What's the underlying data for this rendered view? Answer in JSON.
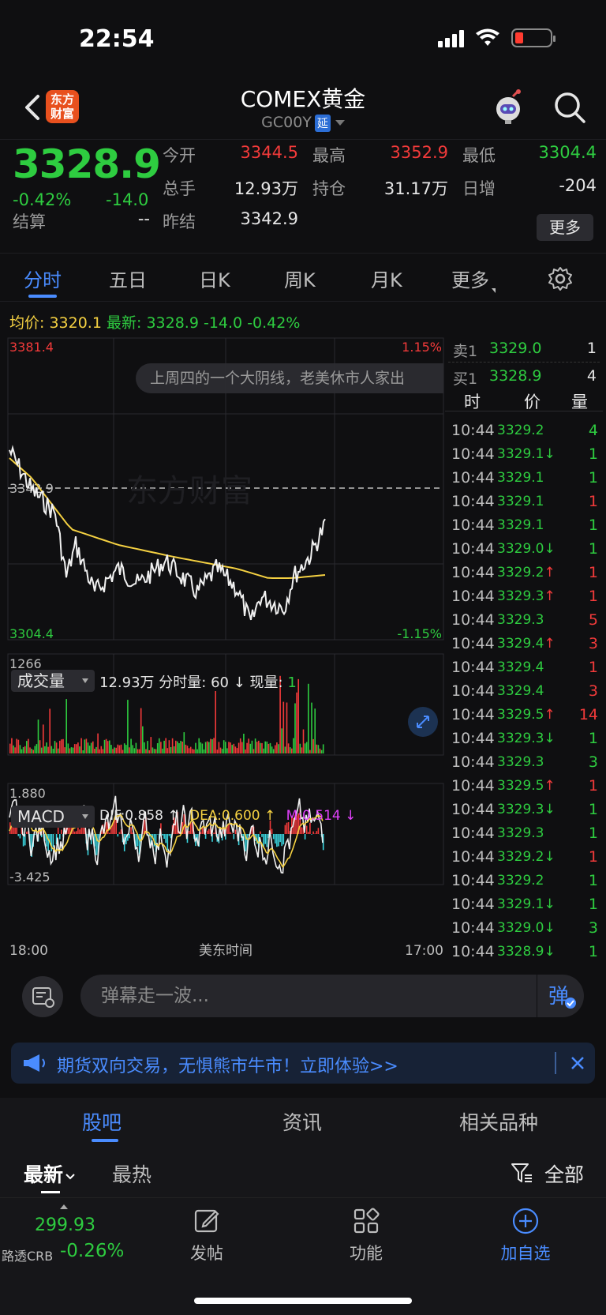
{
  "status": {
    "time": "22:54"
  },
  "nav": {
    "logo_text": "东方财富",
    "title": "COMEX黄金",
    "code": "GC00Y",
    "delay_tag": "延"
  },
  "quote": {
    "price": "3328.9",
    "change_pct": "-0.42%",
    "change_abs": "-14.0",
    "open_label": "今开",
    "open": "3344.5",
    "high_label": "最高",
    "high": "3352.9",
    "low_label": "最低",
    "low": "3304.4",
    "volume_label": "总手",
    "volume": "12.93万",
    "oi_label": "持仓",
    "oi": "31.17万",
    "daily_inc_label": "日增",
    "daily_inc": "-204",
    "settle_label": "结算",
    "settle": "--",
    "prev_settle_label": "昨结",
    "prev_settle": "3342.9",
    "more_label": "更多"
  },
  "period_tabs": [
    "分时",
    "五日",
    "日K",
    "周K",
    "月K",
    "更多"
  ],
  "avg_line": {
    "avg_label": "均价:",
    "avg": "3320.1",
    "latest_label": "最新:",
    "latest": "3328.9",
    "chg": "-14.0",
    "pct": "-0.42%"
  },
  "chart": {
    "y_max": "3381.4",
    "y_mid": "3342.9",
    "y_min": "3304.4",
    "pct_max": "1.15%",
    "pct_min": "-1.15%",
    "watermark": "东方财富",
    "ticker": "上周四的一个大阴线，老美休市人家出",
    "vol_max": "1266",
    "macd_max": "1.880",
    "macd_min": "-3.425",
    "x_start": "18:00",
    "x_mid": "美东时间",
    "x_end": "17:00"
  },
  "volume_panel": {
    "label": "成交量",
    "total": "12.93万",
    "fs_label": "分时量:",
    "fs_val": "60",
    "now_label": "现量:",
    "now_val": "1"
  },
  "macd_panel": {
    "label": "MACD",
    "dif": "DIF:0.858 ↑",
    "dea": "DEA:0.600 ↑",
    "m": "M:0.514 ↓"
  },
  "order_book": {
    "sell_label": "卖1",
    "sell_price": "3329.0",
    "sell_vol": "1",
    "buy_label": "买1",
    "buy_price": "3328.9",
    "buy_vol": "4",
    "head_time": "时",
    "head_price": "价",
    "head_vol": "量"
  },
  "trades": [
    {
      "time": "10:44",
      "price": "3329.2",
      "dir": "",
      "vol": "4",
      "pc": "g",
      "vc": "g"
    },
    {
      "time": "10:44",
      "price": "3329.1",
      "dir": "↓",
      "vol": "1",
      "pc": "g",
      "vc": "g"
    },
    {
      "time": "10:44",
      "price": "3329.1",
      "dir": "",
      "vol": "1",
      "pc": "g",
      "vc": "g"
    },
    {
      "time": "10:44",
      "price": "3329.1",
      "dir": "",
      "vol": "1",
      "pc": "g",
      "vc": "r"
    },
    {
      "time": "10:44",
      "price": "3329.1",
      "dir": "",
      "vol": "1",
      "pc": "g",
      "vc": "g"
    },
    {
      "time": "10:44",
      "price": "3329.0",
      "dir": "↓",
      "vol": "1",
      "pc": "g",
      "vc": "g"
    },
    {
      "time": "10:44",
      "price": "3329.2",
      "dir": "↑",
      "vol": "1",
      "pc": "g",
      "vc": "r"
    },
    {
      "time": "10:44",
      "price": "3329.3",
      "dir": "↑",
      "vol": "1",
      "pc": "g",
      "vc": "r"
    },
    {
      "time": "10:44",
      "price": "3329.3",
      "dir": "",
      "vol": "5",
      "pc": "g",
      "vc": "r"
    },
    {
      "time": "10:44",
      "price": "3329.4",
      "dir": "↑",
      "vol": "3",
      "pc": "g",
      "vc": "r"
    },
    {
      "time": "10:44",
      "price": "3329.4",
      "dir": "",
      "vol": "1",
      "pc": "g",
      "vc": "r"
    },
    {
      "time": "10:44",
      "price": "3329.4",
      "dir": "",
      "vol": "3",
      "pc": "g",
      "vc": "r"
    },
    {
      "time": "10:44",
      "price": "3329.5",
      "dir": "↑",
      "vol": "14",
      "pc": "g",
      "vc": "r"
    },
    {
      "time": "10:44",
      "price": "3329.3",
      "dir": "↓",
      "vol": "1",
      "pc": "g",
      "vc": "g"
    },
    {
      "time": "10:44",
      "price": "3329.3",
      "dir": "",
      "vol": "3",
      "pc": "g",
      "vc": "g"
    },
    {
      "time": "10:44",
      "price": "3329.5",
      "dir": "↑",
      "vol": "1",
      "pc": "g",
      "vc": "r"
    },
    {
      "time": "10:44",
      "price": "3329.3",
      "dir": "↓",
      "vol": "1",
      "pc": "g",
      "vc": "g"
    },
    {
      "time": "10:44",
      "price": "3329.3",
      "dir": "",
      "vol": "1",
      "pc": "g",
      "vc": "g"
    },
    {
      "time": "10:44",
      "price": "3329.2",
      "dir": "↓",
      "vol": "1",
      "pc": "g",
      "vc": "r"
    },
    {
      "time": "10:44",
      "price": "3329.2",
      "dir": "",
      "vol": "1",
      "pc": "g",
      "vc": "g"
    },
    {
      "time": "10:44",
      "price": "3329.1",
      "dir": "↓",
      "vol": "1",
      "pc": "g",
      "vc": "g"
    },
    {
      "time": "10:44",
      "price": "3329.0",
      "dir": "↓",
      "vol": "3",
      "pc": "g",
      "vc": "g"
    },
    {
      "time": "10:44",
      "price": "3328.9",
      "dir": "↓",
      "vol": "1",
      "pc": "g",
      "vc": "g"
    }
  ],
  "danmu": {
    "placeholder": "弹幕走一波..."
  },
  "promo": {
    "text": "期货双向交易，无惧熊市牛市！立即体验>>"
  },
  "bottom_tabs": [
    "股吧",
    "资讯",
    "相关品种"
  ],
  "feed_filter": {
    "newest": "最新",
    "hot": "最热",
    "all": "全部"
  },
  "bottom_bar": {
    "price": "299.93",
    "name": "路透CRB",
    "pct": "-0.26%",
    "post": "发帖",
    "func": "功能",
    "add": "加自选"
  },
  "colors": {
    "up": "#f23a3a",
    "down": "#2ecc40",
    "accent": "#4a8cff",
    "avg": "#f5d142",
    "macd_m": "#e040fb"
  }
}
